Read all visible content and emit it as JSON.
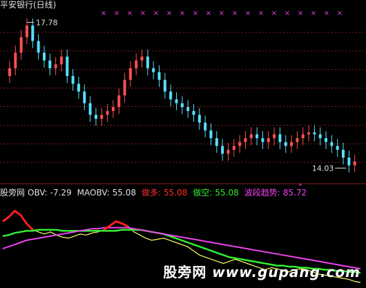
{
  "window": {
    "title": "平安银行(日线)"
  },
  "watermark": {
    "brand": "股旁网",
    "url": "www.gupang.com"
  },
  "legend": {
    "prefix": "股旁网",
    "obv": {
      "label": "OBV:",
      "value": "-7.29",
      "color": "#e0e0e0"
    },
    "maobv": {
      "label": "MAOBV:",
      "value": "55.08",
      "color": "#e0e0e0"
    },
    "zuoduo": {
      "label": "做多:",
      "value": "55.08",
      "color": "#ff3030"
    },
    "zuokong": {
      "label": "做空:",
      "value": "55.08",
      "color": "#33ee33"
    },
    "trend": {
      "label": "波段趋势:",
      "value": "85.72",
      "color": "#ee44ee"
    }
  },
  "chart_data": [
    {
      "type": "candlestick",
      "title": "平安银行(日线)",
      "annotations": [
        {
          "text": "17.78",
          "value": 17.78,
          "kind": "high"
        },
        {
          "text": "14.03",
          "value": 14.03,
          "kind": "low"
        }
      ],
      "ylim": [
        13.7,
        18.0
      ],
      "grid": true,
      "series": [
        {
          "values": [
            16.6,
            17.0,
            17.4,
            17.7,
            17.3,
            17.0,
            16.8,
            16.6,
            16.7,
            16.9,
            16.4,
            16.2,
            16.0,
            15.7,
            15.4,
            15.3,
            15.4,
            15.5,
            15.6,
            15.9,
            16.3,
            16.6,
            16.8,
            16.9,
            16.6,
            16.5,
            16.3,
            16.0,
            15.8,
            15.7,
            15.6,
            15.5,
            15.4,
            15.2,
            15.0,
            14.8,
            14.6,
            14.4,
            14.5,
            14.6,
            14.7,
            14.8,
            14.9,
            14.8,
            14.7,
            14.8,
            14.9,
            14.7,
            14.6,
            14.7,
            14.8,
            14.9,
            14.95,
            14.9,
            14.8,
            14.7,
            14.6,
            14.5,
            14.3,
            14.1,
            14.2
          ]
        }
      ]
    },
    {
      "type": "line",
      "series": [
        {
          "name": "OBV",
          "values": [
            60,
            64,
            70,
            66,
            58,
            52,
            50,
            48,
            50,
            47,
            45,
            44,
            46,
            48,
            47,
            49,
            50,
            52,
            56,
            60,
            58,
            55,
            50,
            47,
            44,
            42,
            43,
            44,
            42,
            40,
            38,
            36,
            32,
            28,
            26,
            24,
            22,
            20,
            22,
            24,
            22,
            20,
            18,
            16,
            14,
            16,
            15,
            13,
            12,
            14,
            15,
            14,
            12,
            10,
            9,
            8,
            7,
            6,
            5,
            3,
            2
          ]
        },
        {
          "name": "MAOBV",
          "values": [
            46,
            47,
            49,
            50,
            51,
            51,
            52,
            52,
            52,
            52,
            51,
            51,
            51,
            51,
            51,
            51,
            51,
            51,
            51,
            51,
            52,
            52,
            52,
            52,
            51,
            50,
            49,
            48,
            46,
            44,
            42,
            40,
            38,
            36,
            34,
            32,
            30,
            28,
            26,
            25,
            24,
            23,
            22,
            21,
            20,
            19,
            18,
            18,
            17,
            17,
            16,
            16,
            15,
            15,
            14,
            14,
            13,
            13,
            12,
            12,
            11
          ]
        },
        {
          "name": "波段趋势",
          "values": [
            34,
            36,
            38,
            40,
            42,
            43,
            44,
            45,
            46,
            47,
            48,
            49,
            50,
            51,
            52,
            53,
            53,
            54,
            54,
            54,
            54,
            54,
            53,
            52,
            51,
            50,
            49,
            48,
            47,
            46,
            45,
            44,
            43,
            42,
            41,
            40,
            39,
            38,
            37,
            36,
            35,
            34,
            33,
            32,
            31,
            30,
            29,
            28,
            27,
            26,
            25,
            24,
            23,
            22,
            21,
            20,
            19,
            18,
            17,
            16,
            15
          ]
        }
      ],
      "ylim": [
        0,
        80
      ]
    }
  ]
}
